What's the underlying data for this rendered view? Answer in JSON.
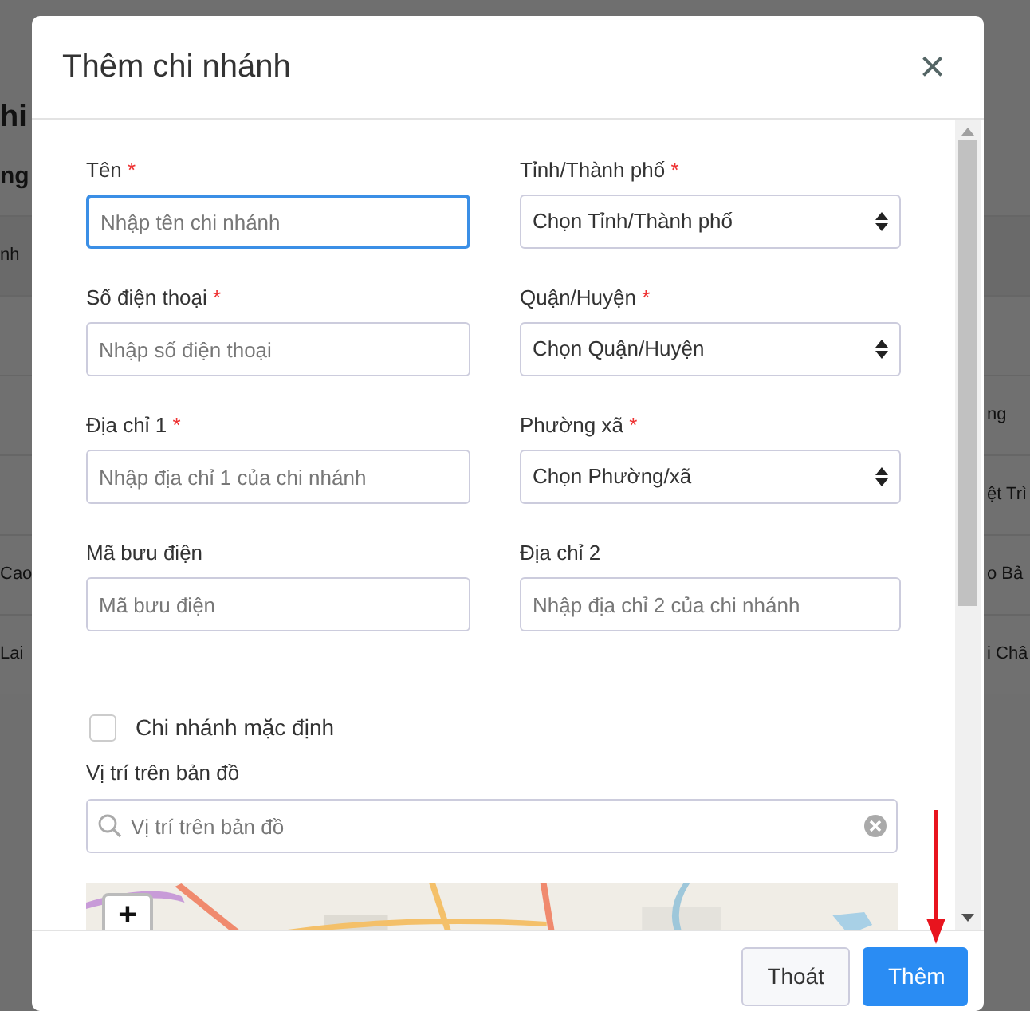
{
  "background": {
    "title": "hi",
    "subtitle": "ng",
    "rows": [
      {
        "column_1": "nh"
      },
      {},
      {
        "column_2": "ng"
      },
      {
        "column_2": "ệt Trì"
      },
      {
        "column_1": "Cao",
        "column_2": "o Bả"
      },
      {
        "column_1": "Lai",
        "column_2": "i Châ"
      }
    ]
  },
  "modal": {
    "title": "Thêm chi nhánh",
    "close": "×",
    "required_mark": "*",
    "fields": [
      {
        "kind": "input",
        "label": "Tên",
        "required": true,
        "placeholder": "Nhập tên chi nhánh",
        "focused": true
      },
      {
        "kind": "select",
        "label": "Tỉnh/Thành phố",
        "required": true,
        "value": "Chọn Tỉnh/Thành phố"
      },
      {
        "kind": "input",
        "label": "Số điện thoại",
        "required": true,
        "placeholder": "Nhập số điện thoại",
        "focused": false
      },
      {
        "kind": "select",
        "label": "Quận/Huyện",
        "required": true,
        "value": "Chọn Quận/Huyện"
      },
      {
        "kind": "input",
        "label": "Địa chỉ 1",
        "required": true,
        "placeholder": "Nhập địa chỉ 1 của chi nhánh",
        "focused": false
      },
      {
        "kind": "select",
        "label": "Phường xã",
        "required": true,
        "value": "Chọn Phường/xã"
      },
      {
        "kind": "input",
        "label": "Mã bưu điện",
        "required": false,
        "placeholder": "Mã bưu điện",
        "focused": false
      },
      {
        "kind": "input",
        "label": "Địa chỉ 2",
        "required": false,
        "placeholder": "Nhập địa chỉ 2 của chi nhánh",
        "focused": false
      }
    ],
    "default_branch": {
      "label": "Chi nhánh mặc định",
      "checked": false
    },
    "map_search": {
      "label": "Vị trí trên bản đồ",
      "placeholder": "Vị trí trên bản đồ"
    },
    "map": {
      "kind": "picture",
      "zoom_in": "+"
    },
    "buttons": [
      {
        "kind": "secondary",
        "label": "Thoát"
      },
      {
        "kind": "primary",
        "label": "Thêm"
      }
    ]
  }
}
